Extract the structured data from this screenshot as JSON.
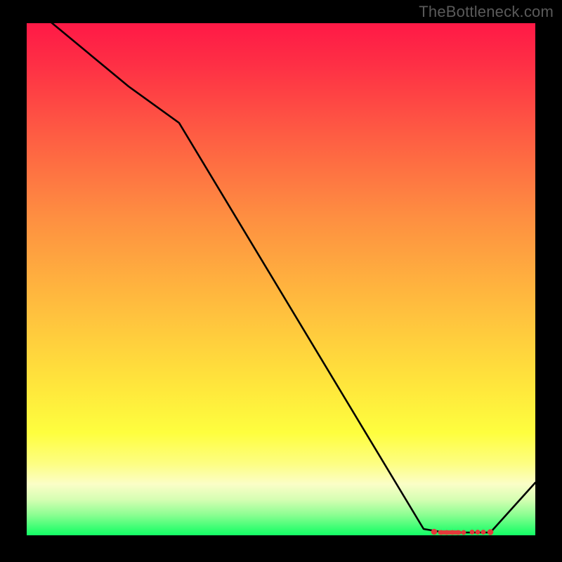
{
  "attribution": "TheBottleneck.com",
  "chart_data": {
    "type": "line",
    "title": "",
    "xlabel": "",
    "ylabel": "",
    "x": [
      0,
      20,
      30,
      78,
      82,
      91,
      100
    ],
    "values": [
      104,
      91,
      84,
      1,
      0,
      0,
      10
    ],
    "ylim": [
      0,
      104
    ],
    "annotations_x_range": [
      82,
      91
    ]
  },
  "gradient": {
    "stops": [
      {
        "pos": 0,
        "color": "#ff1946"
      },
      {
        "pos": 8,
        "color": "#fe2f45"
      },
      {
        "pos": 22,
        "color": "#fe5d43"
      },
      {
        "pos": 38,
        "color": "#fe8f41"
      },
      {
        "pos": 54,
        "color": "#ffba3e"
      },
      {
        "pos": 70,
        "color": "#ffe43c"
      },
      {
        "pos": 80,
        "color": "#fefe3e"
      },
      {
        "pos": 86,
        "color": "#fdfe82"
      },
      {
        "pos": 90,
        "color": "#fbfec7"
      },
      {
        "pos": 93,
        "color": "#d6feb3"
      },
      {
        "pos": 96,
        "color": "#8cfe92"
      },
      {
        "pos": 99,
        "color": "#2efe6f"
      },
      {
        "pos": 100,
        "color": "#14fe66"
      }
    ]
  }
}
